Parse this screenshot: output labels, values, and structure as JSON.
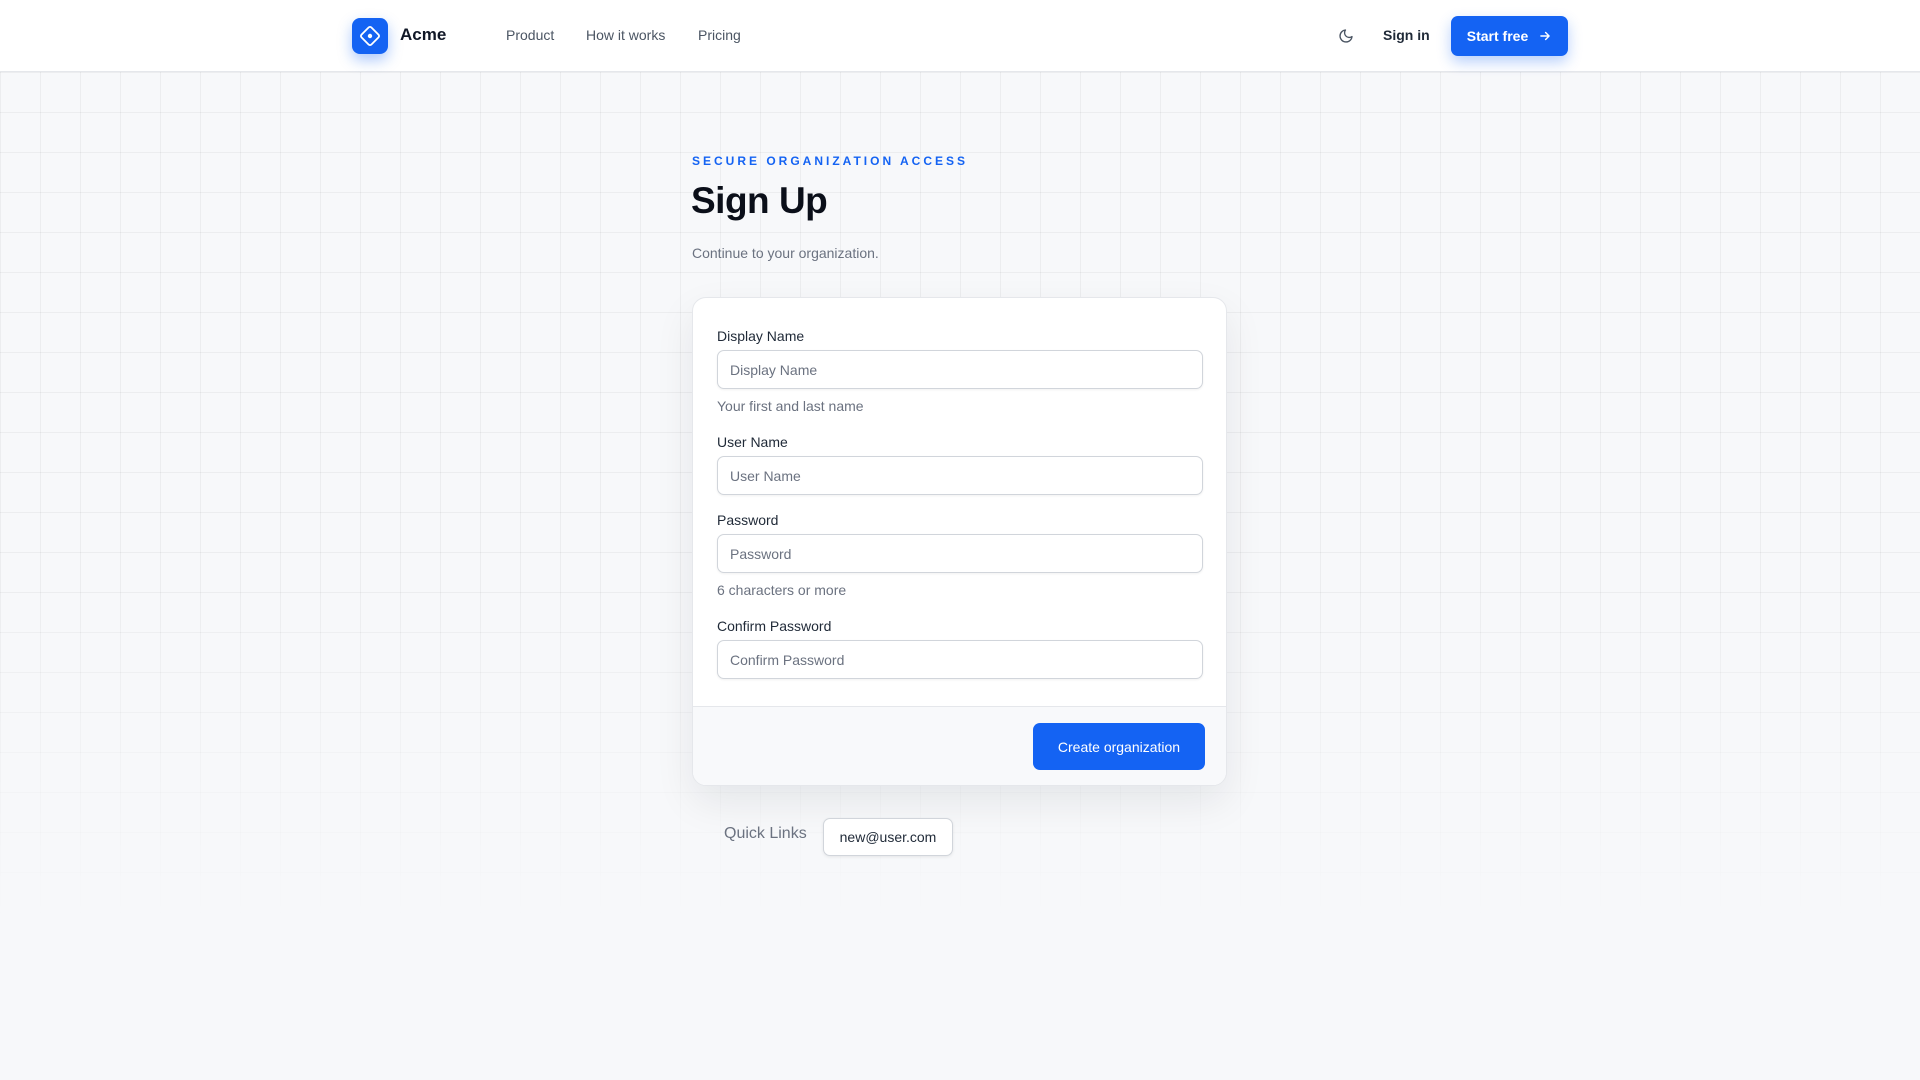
{
  "header": {
    "brand": "Acme",
    "nav": [
      "Product",
      "How it works",
      "Pricing"
    ],
    "theme_icon": "moon-icon",
    "sign_in": "Sign in",
    "start_free": "Start free",
    "start_free_icon": "arrow-right-icon",
    "logo_icon": "diamond-logo-icon"
  },
  "hero": {
    "eyebrow": "SECURE ORGANIZATION ACCESS",
    "title": "Sign Up",
    "subtitle": "Continue to your organization."
  },
  "form": {
    "fields": [
      {
        "label": "Display Name",
        "placeholder": "Display Name",
        "hint": "Your first and last name",
        "value": ""
      },
      {
        "label": "User Name",
        "placeholder": "User Name",
        "hint": "",
        "value": ""
      },
      {
        "label": "Password",
        "placeholder": "Password",
        "hint": "6 characters or more",
        "value": ""
      },
      {
        "label": "Confirm Password",
        "placeholder": "Confirm Password",
        "hint": "",
        "value": ""
      }
    ],
    "submit": "Create organization"
  },
  "quick_links": {
    "label": "Quick Links",
    "items": [
      "new@user.com"
    ]
  },
  "colors": {
    "accent": "#1463f3",
    "background": "#f7f8fa",
    "text": "#111827",
    "muted": "#6b7280"
  }
}
